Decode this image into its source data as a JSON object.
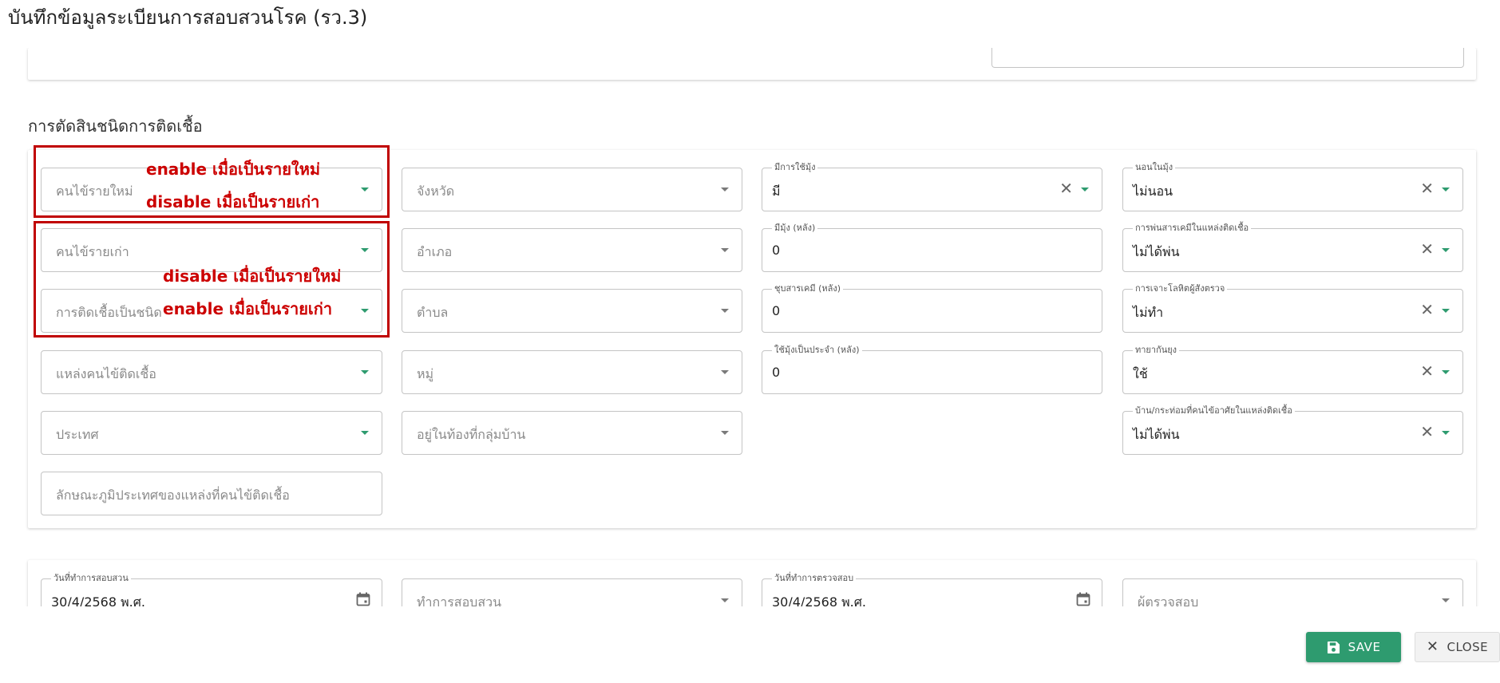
{
  "page": {
    "title": "บันทึกข้อมูลระเบียนการสอบสวนโรค (รว.3)"
  },
  "section": {
    "title": "การตัดสินชนิดการติดเชื้อ"
  },
  "annotations": {
    "new_line1": "enable เมื่อเป็นรายใหม่",
    "new_line2": "disable เมื่อเป็นรายเก่า",
    "old_line1": "disable เมื่อเป็นรายใหม่",
    "old_line2": "enable เมื่อเป็นรายเก่า",
    "color": "#cc0000"
  },
  "col1": {
    "new_patient": {
      "placeholder": "คนไข้รายใหม่"
    },
    "old_patient": {
      "placeholder": "คนไข้รายเก่า"
    },
    "infection_type": {
      "placeholder": "การติดเชื้อเป็นชนิด"
    },
    "source": {
      "placeholder": "แหล่งคนไข้ติดเชื้อ"
    },
    "country": {
      "placeholder": "ประเทศ"
    },
    "geography": {
      "placeholder": "ลักษณะภูมิประเทศของแหล่งที่คนไข้ติดเชื้อ"
    }
  },
  "col2": {
    "province": {
      "placeholder": "จังหวัด"
    },
    "district": {
      "placeholder": "อำเภอ"
    },
    "subdistrict": {
      "placeholder": "ตำบล"
    },
    "village": {
      "placeholder": "หมู่"
    },
    "cluster": {
      "placeholder": "อยู่ในท้องที่กลุ่มบ้าน"
    }
  },
  "col3": {
    "has_net": {
      "label": "มีการใช้มุ้ง",
      "value": "มี"
    },
    "nets_after": {
      "label": "มีมุ้ง (หลัง)",
      "value": "0"
    },
    "dip_after": {
      "label": "ชุบสารเคมี (หลัง)",
      "value": "0"
    },
    "regular_after": {
      "label": "ใช้มุ้งเป็นประจำ (หลัง)",
      "value": "0"
    }
  },
  "col4": {
    "sleep_in_net": {
      "label": "นอนในมุ้ง",
      "value": "ไม่นอน"
    },
    "spray": {
      "label": "การพ่นสารเคมีในแหล่งติดเชื้อ",
      "value": "ไม่ได้พ่น"
    },
    "blood_test": {
      "label": "การเจาะโลหิตผู้สังตรวจ",
      "value": "ไม่ทำ"
    },
    "repellent": {
      "label": "ทายากันยุง",
      "value": "ใช้"
    },
    "house_spray": {
      "label": "บ้าน/กระท่อมที่คนไข้อาศัยในแหล่งติดเชื้อ",
      "value": "ไม่ได้พ่น"
    }
  },
  "bottom": {
    "investigation_date": {
      "label": "วันที่ทำการสอบสวน",
      "value": "30/4/2568 พ.ศ."
    },
    "investigator": {
      "placeholder": "ทำการสอบสวน"
    },
    "inspection_date": {
      "label": "วันที่ทำการตรวจสอบ",
      "value": "30/4/2568 พ.ศ."
    },
    "inspector": {
      "placeholder": "ผู้ตรวจสอบ"
    }
  },
  "buttons": {
    "save": "SAVE",
    "close": "CLOSE"
  },
  "icons": {
    "dropdown": "chevron-down-icon",
    "clear": "close-icon",
    "calendar": "calendar-icon",
    "save": "floppy-disk-icon",
    "close": "close-icon"
  },
  "colors": {
    "accent": "#2e9b6f",
    "annotation": "#cc0000"
  }
}
